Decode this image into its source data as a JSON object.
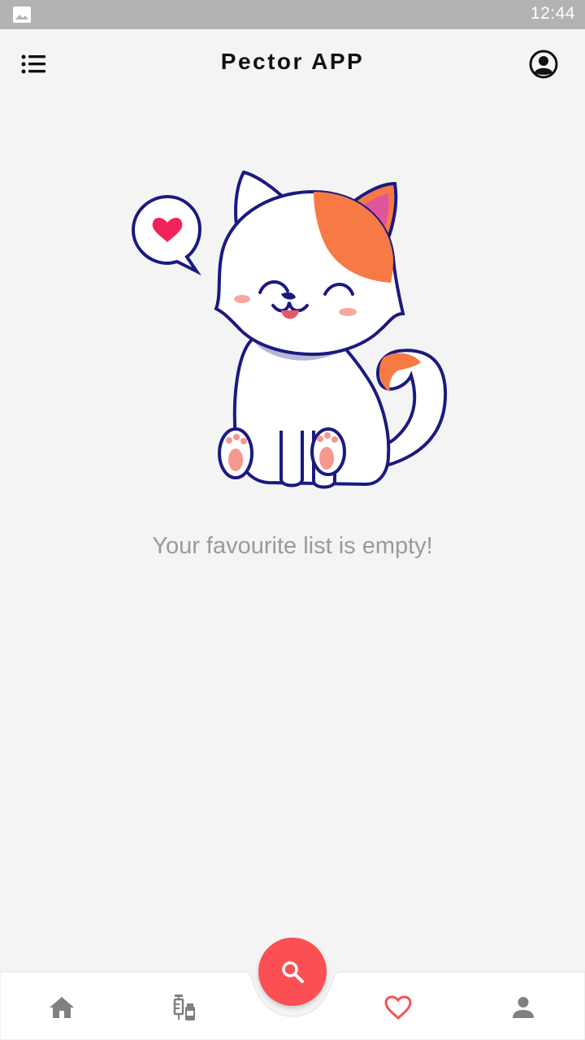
{
  "status_bar": {
    "time": "12:44",
    "notification_icon": "image-icon"
  },
  "app_bar": {
    "title": "Pector APP",
    "menu_icon": "list-menu-icon",
    "account_icon": "account-circle-icon"
  },
  "content": {
    "illustration": "cat-with-heart-illustration",
    "empty_message": "Your favourite list is empty!"
  },
  "bottom_nav": {
    "items": [
      {
        "icon": "home-icon",
        "active": false
      },
      {
        "icon": "vaccine-icon",
        "active": false
      },
      {
        "icon": "heart-icon",
        "active": true
      },
      {
        "icon": "person-icon",
        "active": false
      }
    ],
    "fab_icon": "search-icon"
  },
  "colors": {
    "accent": "#fa5053",
    "inactive_icon": "#808080",
    "background": "#f4f4f5",
    "status_bar": "#b3b3b3"
  }
}
